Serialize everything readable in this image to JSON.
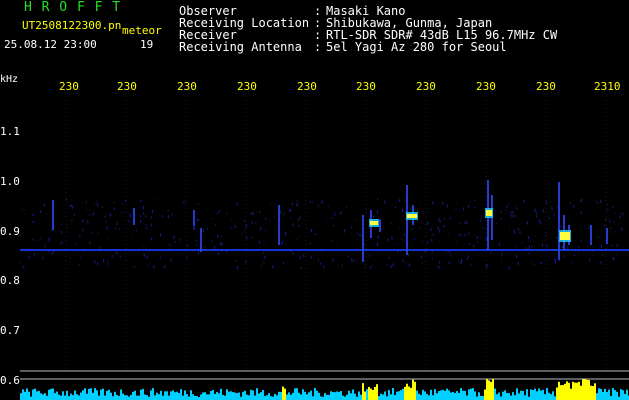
{
  "header": {
    "brand": "H R O F F T",
    "filename": "UT2508122300.pn",
    "meteor_label": "meteor",
    "datetime": "25.08.12 23:00",
    "meteor_count": "19",
    "fields": [
      {
        "label": "Observer",
        "value": "Masaki Kano"
      },
      {
        "label": "Receiving Location",
        "value": "Shibukawa, Gunma, Japan"
      },
      {
        "label": "Receiver",
        "value": "RTL-SDR SDR# 43dB L15 96.7MHz CW"
      },
      {
        "label": "Receiving Antenna",
        "value": "5el Yagi Az 280 for Seoul"
      }
    ]
  },
  "axes": {
    "y_unit": "kHz",
    "y_ticks": [
      "1.1",
      "1.0",
      "0.9",
      "0.8",
      "0.7",
      "0.6"
    ],
    "x_ticks": [
      "230",
      "230",
      "230",
      "230",
      "230",
      "230",
      "230",
      "230",
      "230",
      "2310"
    ]
  },
  "colors": {
    "background": "#000000",
    "carrier": "#2a4cff",
    "echo_hot": "#ffff40",
    "histogram": "#00d8ff",
    "histogram_peak": "#ffff00"
  }
}
